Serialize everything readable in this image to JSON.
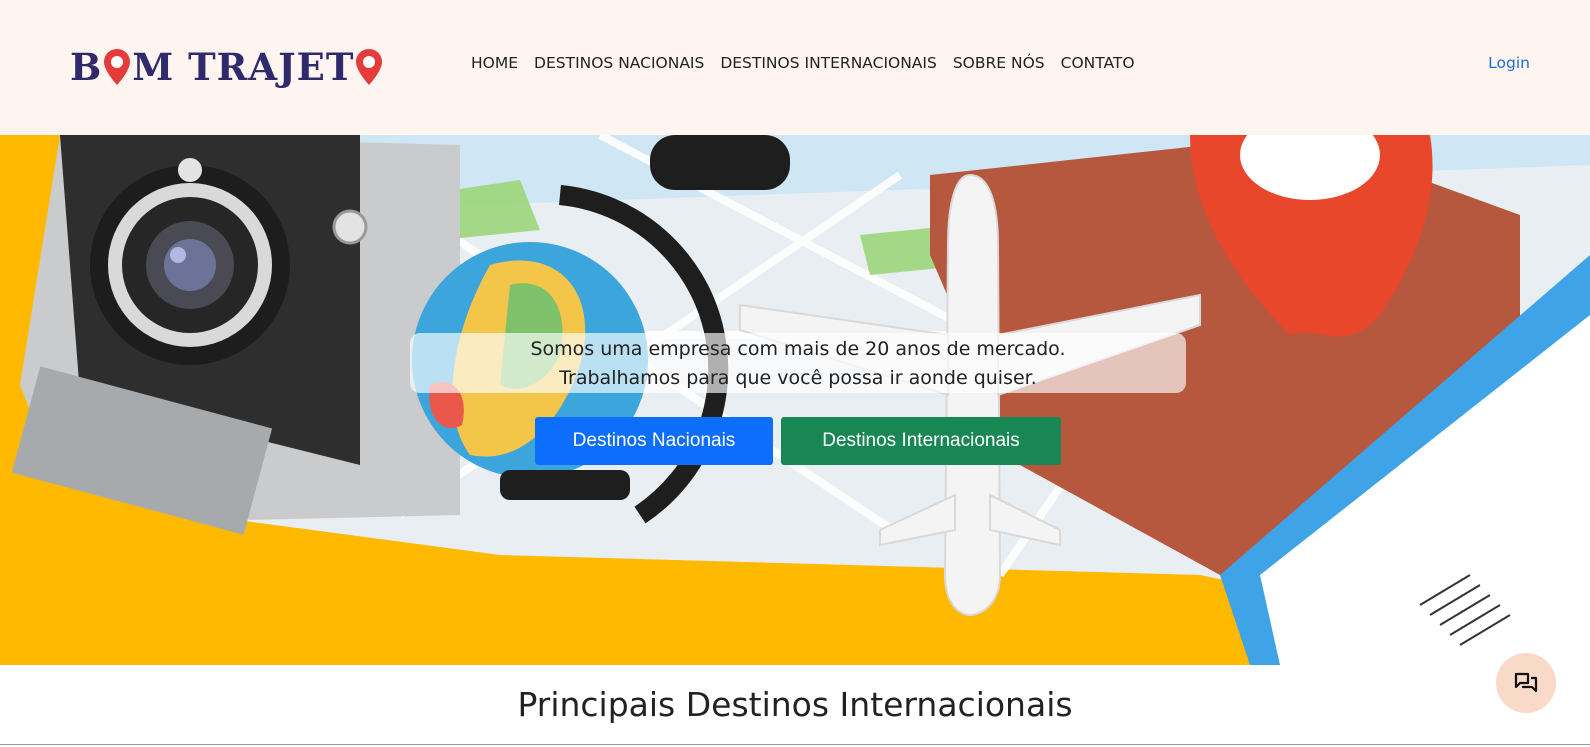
{
  "brand": {
    "logo_text_before": "B",
    "logo_text_middle": "M TRAJET",
    "pin_color": "#e63b3b",
    "text_color": "#2f2a6b"
  },
  "nav": {
    "items": [
      {
        "label": "HOME"
      },
      {
        "label": "DESTINOS NACIONAIS"
      },
      {
        "label": "DESTINOS INTERNACIONAIS"
      },
      {
        "label": "SOBRE NÓS"
      },
      {
        "label": "CONTATO"
      }
    ],
    "login_label": "Login"
  },
  "hero": {
    "tagline_line1": "Somos uma empresa com mais de 20 anos de mercado.",
    "tagline_line2": "Trabalhamos para que você possa ir aonde quiser.",
    "btn_national": "Destinos Nacionais",
    "btn_international": "Destinos Internacionais",
    "colors": {
      "primary": "#0d6efd",
      "success": "#198754",
      "background": "#ffb900"
    }
  },
  "section": {
    "title": "Principais Destinos Internacionais"
  },
  "chat_fab": {
    "icon": "chat-icon"
  }
}
